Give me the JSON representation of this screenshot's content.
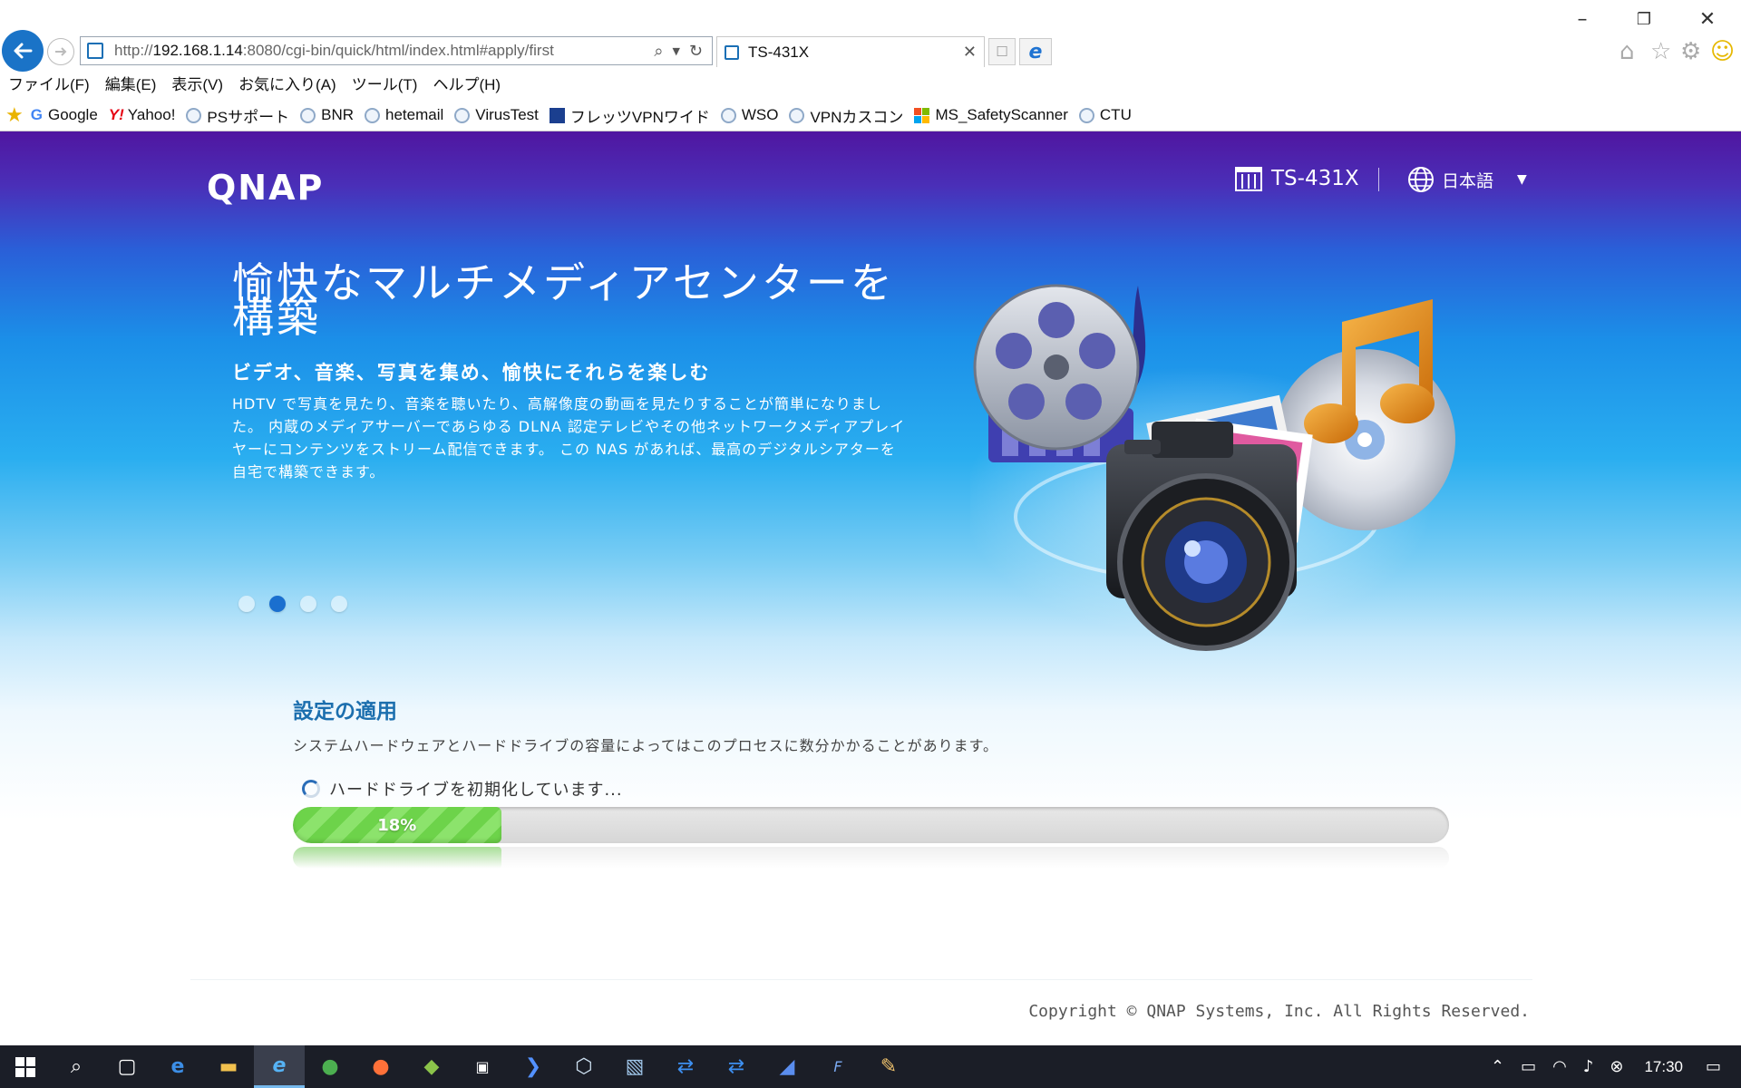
{
  "browser": {
    "url_prefix": "http://",
    "url_host": "192.168.1.14",
    "url_rest": ":8080/cgi-bin/quick/html/index.html#apply/first",
    "tab_title": "TS-431X",
    "menu": [
      "ファイル(F)",
      "編集(E)",
      "表示(V)",
      "お気に入り(A)",
      "ツール(T)",
      "ヘルプ(H)"
    ],
    "favorites": [
      "Google",
      "Yahoo!",
      "PSサポート",
      "BNR",
      "hetemail",
      "VirusTest",
      "フレッツVPNワイド",
      "WSO",
      "VPNカスコン",
      "MS_SafetyScanner",
      "CTU"
    ]
  },
  "header": {
    "logo": "QNAP",
    "model": "TS-431X",
    "language": "日本語"
  },
  "hero": {
    "title": "愉快なマルチメディアセンターを構築",
    "subtitle": "ビデオ、音楽、写真を集め、愉快にそれらを楽しむ",
    "description": "HDTV で写真を見たり、音楽を聴いたり、高解像度の動画を見たりすることが簡単になりました。 内蔵のメディアサーバーであらゆる DLNA 認定テレビやその他ネットワークメディアプレイヤーにコンテンツをストリーム配信できます。 この NAS があれば、最高のデジタルシアターを自宅で構築できます。",
    "slide_count": 4,
    "active_slide": 2
  },
  "apply": {
    "title": "設定の適用",
    "note": "システムハードウェアとハードドライブの容量によってはこのプロセスに数分かかることがあります。",
    "status": "ハードドライブを初期化しています...",
    "progress_percent": 18,
    "progress_label": "18%"
  },
  "footer": {
    "copyright": "Copyright © QNAP Systems, Inc. All Rights Reserved."
  },
  "taskbar": {
    "time": "17:30"
  },
  "colors": {
    "accent": "#1c6fae",
    "progress": "#6dd34a",
    "header_bg": "#5016a0"
  }
}
